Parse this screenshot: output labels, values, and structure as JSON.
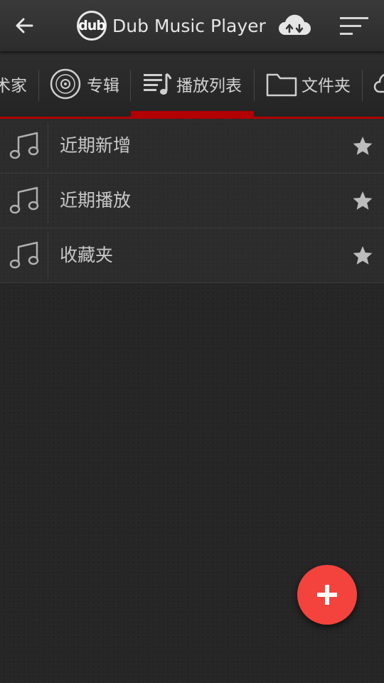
{
  "header": {
    "logo_text": "dub",
    "app_title": "Dub Music Player",
    "icons": {
      "back": "arrow-left-icon",
      "cloud": "cloud-sync-icon",
      "sort": "sort-icon"
    }
  },
  "tabs": [
    {
      "label": "术家",
      "icon": "none"
    },
    {
      "label": "专辑",
      "icon": "vinyl-disc-icon"
    },
    {
      "label": "播放列表",
      "icon": "playlist-icon",
      "active": true
    },
    {
      "label": "文件夹",
      "icon": "folder-icon"
    },
    {
      "label": "",
      "icon": "cloud-icon"
    }
  ],
  "playlists": [
    {
      "label": "近期新增",
      "icon": "music-note-icon",
      "action_icon": "star-icon"
    },
    {
      "label": "近期播放",
      "icon": "music-note-icon",
      "action_icon": "star-icon"
    },
    {
      "label": "收藏夹",
      "icon": "music-note-icon",
      "action_icon": "star-icon"
    }
  ],
  "fab": {
    "icon": "plus-icon",
    "color": "#f4433c"
  },
  "colors": {
    "accent": "#b20000",
    "fab": "#f4433c",
    "background": "#262626",
    "toolbar": "#333333",
    "text": "#c8c8c8"
  }
}
